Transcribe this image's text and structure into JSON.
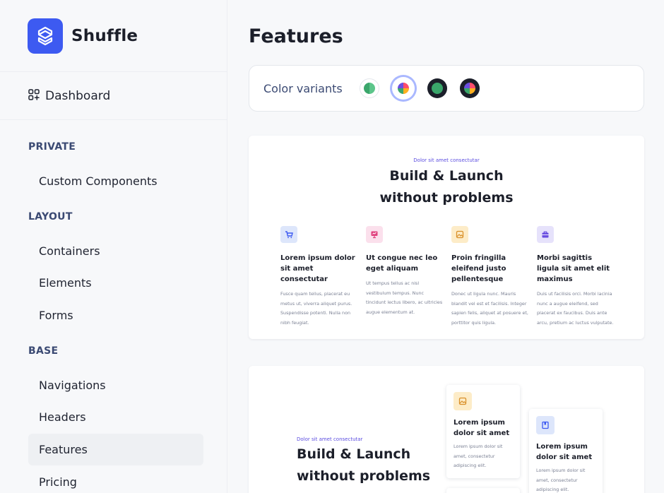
{
  "brand": {
    "name": "Shuffle",
    "color": "#3d5af1"
  },
  "sidebar": {
    "dashboard": {
      "label": "Dashboard",
      "icon": "grid-plus-icon"
    },
    "sections": [
      {
        "title": "PRIVATE",
        "items": [
          {
            "label": "Custom Components",
            "active": false
          }
        ]
      },
      {
        "title": "LAYOUT",
        "items": [
          {
            "label": "Containers",
            "active": false
          },
          {
            "label": "Elements",
            "active": false
          },
          {
            "label": "Forms",
            "active": false
          }
        ]
      },
      {
        "title": "BASE",
        "items": [
          {
            "label": "Navigations",
            "active": false
          },
          {
            "label": "Headers",
            "active": false
          },
          {
            "label": "Features",
            "active": true
          },
          {
            "label": "Pricing",
            "active": false
          }
        ]
      }
    ]
  },
  "main": {
    "title": "Features",
    "variants": {
      "label": "Color variants",
      "swatches": [
        {
          "name": "green-light",
          "selected": false
        },
        {
          "name": "multicolor-light",
          "selected": true
        },
        {
          "name": "green-dark",
          "selected": false
        },
        {
          "name": "multicolor-dark",
          "selected": false
        }
      ]
    },
    "preview1": {
      "eyebrow": "Dolor sit amet consectutar",
      "title_line1": "Build & Launch",
      "title_line2": "without problems",
      "features": [
        {
          "icon": "cart-icon",
          "icon_bg": "#dde6fb",
          "icon_color": "#3d5af1",
          "title": "Lorem ipsum dolor sit amet consectutar",
          "text": "Fusce quam tellus, placerat eu metus ut, viverra aliquet purus. Suspendisse potenti. Nulla non nibh feugiat."
        },
        {
          "icon": "presentation-icon",
          "icon_bg": "#fbe0ec",
          "icon_color": "#e0417e",
          "title": "Ut congue nec leo eget aliquam",
          "text": "Ut tempus tellus ac nisl vestibulum tempus. Nunc tincidunt lectus libero, ac ultricies augue elementum at."
        },
        {
          "icon": "image-icon",
          "icon_bg": "#fdecc8",
          "icon_color": "#d9902a",
          "title": "Proin fringilla eleifend justo pellentesque",
          "text": "Donec ut ligula nunc. Mauris blandit vel est et facilisis. Integer sapien felis, aliquet at posuere et, porttitor quis ligula."
        },
        {
          "icon": "briefcase-icon",
          "icon_bg": "#e6e2fb",
          "icon_color": "#6a4ee0",
          "title": "Morbi sagittis ligula sit amet elit maximus",
          "text": "Duis ut facilisis orci. Morbi lacinia nunc a augue eleifend, sed placerat ex faucibus. Duis ante arcu, pretium ac luctus vulputate."
        }
      ]
    },
    "preview2": {
      "eyebrow": "Dolor sit amet consectutar",
      "title_line1": "Build & Launch",
      "title_line2": "without problems",
      "cards": [
        {
          "icon": "image-icon",
          "icon_bg": "#fdecc8",
          "icon_color": "#d9902a",
          "title": "Lorem ipsum dolor sit amet",
          "text": "Lorem ipsum dolor sit amet, consectetur adipiscing elit."
        },
        {
          "icon": "book-icon",
          "icon_bg": "#dde6fb",
          "icon_color": "#3d5af1",
          "title": "Lorem ipsum dolor sit amet",
          "text": "Lorem ipsum dolor sit amet, consectetur adipiscing elit."
        }
      ]
    }
  }
}
